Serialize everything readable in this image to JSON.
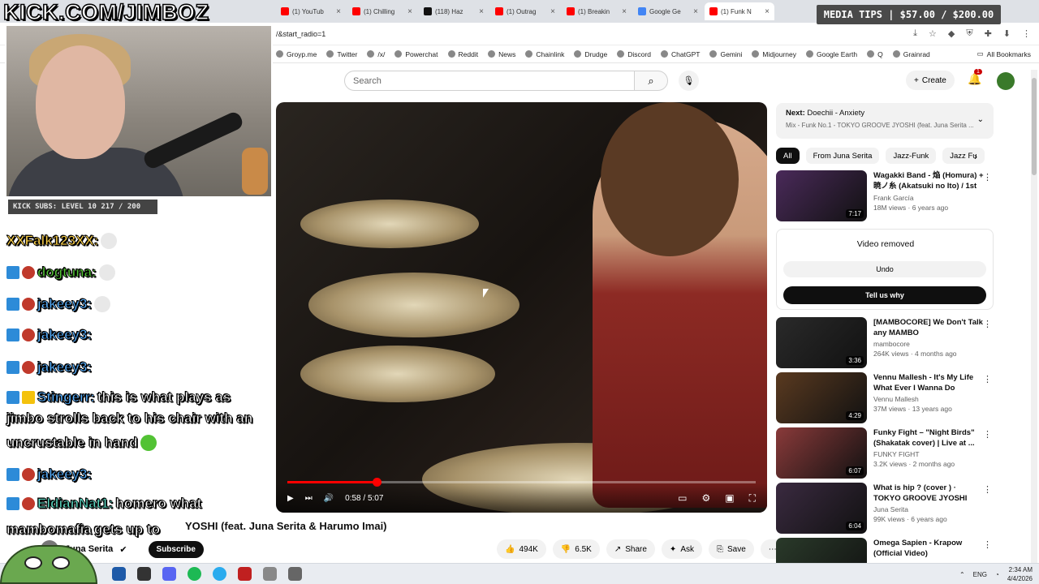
{
  "stream": {
    "brand": "KICK.COM/JIMBOZ",
    "subs_goal": "KICK SUBS: LEVEL 10 217 / 200",
    "media_tips": "MEDIA TIPS | $57.00 / $200.00"
  },
  "browser": {
    "tabs": [
      {
        "label": "(1) YouTub",
        "color": "#ff0000"
      },
      {
        "label": "(1) Chilling",
        "color": "#ff0000"
      },
      {
        "label": "(118) Haz",
        "color": "#111111"
      },
      {
        "label": "(1) Outrag",
        "color": "#ff0000"
      },
      {
        "label": "(1) Breakin",
        "color": "#ff0000"
      },
      {
        "label": "Google Ge",
        "color": "#4285f4"
      },
      {
        "label": "(1) Funk N",
        "color": "#ff0000",
        "active": true
      }
    ],
    "url": "/&start_radio=1",
    "bookmarks": [
      "Groyp.me",
      "Twitter",
      "/x/",
      "Powerchat",
      "Reddit",
      "News",
      "Chainlink",
      "Drudge",
      "Discord",
      "ChatGPT",
      "Gemini",
      "Midjourney",
      "Google Earth",
      "Q",
      "Grainrad"
    ],
    "all_bookmarks": "All Bookmarks"
  },
  "youtube": {
    "search_placeholder": "Search",
    "create_label": "Create",
    "notif_count": "1",
    "player": {
      "time": "0:58 / 5:07",
      "progress": 0.19
    },
    "video_title_visible": "YOSHI (feat. Juna Serita & Harumo Imai)",
    "channel": "Juna Serita",
    "subscribe": "Subscribe",
    "actions": {
      "likes": "494K",
      "dislikes": "6.5K",
      "share": "Share",
      "ask": "Ask",
      "save": "Save"
    },
    "next": {
      "prefix": "Next:",
      "title": "Doechii - Anxiety",
      "mix": "Mix - Funk No.1 - TOKYO GROOVE JYOSHI (feat. Juna Serita ..."
    },
    "chips": [
      "All",
      "From Juna Serita",
      "Jazz-Funk",
      "Jazz Fu"
    ],
    "removed": {
      "message": "Video removed",
      "undo": "Undo",
      "why": "Tell us why"
    },
    "recommendations": [
      {
        "title": "Wagakki Band - 焔 (Homura) + 暁ノ糸 (Akatsuki no Ito) / 1st ...",
        "channel": "Frank García",
        "views": "18M views · 6 years ago",
        "duration": "7:17",
        "color": "#4a2a5a"
      },
      {
        "title": "[MAMBOCORE] We Don't Talk any MAMBO",
        "channel": "mambocore",
        "views": "264K views · 4 months ago",
        "duration": "3:36",
        "color": "#2a2a2a"
      },
      {
        "title": "Vennu Mallesh - It's My Life What Ever I Wanna Do",
        "channel": "Vennu Mallesh",
        "views": "37M views · 13 years ago",
        "duration": "4:29",
        "color": "#5a3a20"
      },
      {
        "title": "Funky Fight – \"Night Birds\" (Shakatak cover) | Live at ...",
        "channel": "FUNKY FIGHT",
        "views": "3.2K views · 2 months ago",
        "duration": "6:07",
        "color": "#8a3a3a"
      },
      {
        "title": "What is hip ? (cover ) · TOKYO GROOVE JYOSHI",
        "channel": "Juna Serita",
        "views": "99K views · 6 years ago",
        "duration": "6:04",
        "color": "#3a2a40"
      },
      {
        "title": "Omega Sapien - Krapow (Official Video)",
        "channel": "",
        "views": "",
        "duration": "",
        "color": "#2a3a2a"
      }
    ]
  },
  "chat": [
    {
      "user": "XXFalk123XX:",
      "msg": "",
      "userColor": "u-yellow",
      "badges": []
    },
    {
      "user": "dogtuna:",
      "msg": "",
      "userColor": "u-green",
      "badges": [
        "b1",
        "b2"
      ]
    },
    {
      "user": "jakeey3:",
      "msg": "",
      "userColor": "u-blue",
      "badges": [
        "b1",
        "b2"
      ]
    },
    {
      "user": "jakeey3:",
      "msg": "",
      "userColor": "u-blue",
      "badges": [
        "b1",
        "b2"
      ]
    },
    {
      "user": "jakeey3:",
      "msg": "",
      "userColor": "u-blue",
      "badges": [
        "b1",
        "b2"
      ]
    },
    {
      "user": "Stingerr:",
      "msg": "this is what plays as",
      "userColor": "u-blue",
      "badges": [
        "b1",
        "b3"
      ]
    },
    {
      "user": "",
      "msg": "jimbo strolls back to his chair with an",
      "userColor": "",
      "badges": []
    },
    {
      "user": "",
      "msg": "uncrustable in hand",
      "userColor": "",
      "badges": []
    },
    {
      "user": "jakeey3:",
      "msg": "",
      "userColor": "u-blue",
      "badges": [
        "b1",
        "b2"
      ]
    },
    {
      "user": "EldianNat1:",
      "msg": "homero what",
      "userColor": "u-teal",
      "badges": [
        "b1",
        "b2"
      ]
    },
    {
      "user": "mambomafia",
      "msg": "gets up to",
      "userColor": "",
      "badges": []
    }
  ],
  "taskbar": {
    "lang": "ENG",
    "time": "2:34 AM",
    "date": "4/4/2026"
  }
}
